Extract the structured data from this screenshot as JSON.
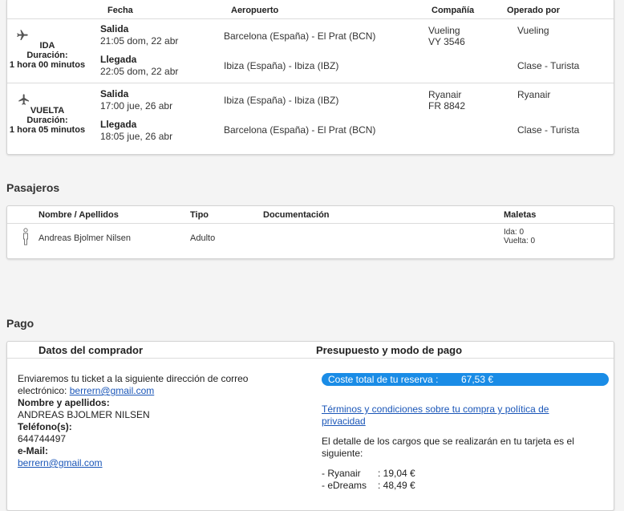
{
  "flights": {
    "headers": {
      "date": "Fecha",
      "airport": "Aeropuerto",
      "company": "Compañía",
      "operated_by": "Operado por"
    },
    "outbound": {
      "label": "IDA",
      "duration_label": "Duración:",
      "duration": "1 hora 00 minutos",
      "departure_label": "Salida",
      "departure_time": "21:05 dom, 22 abr",
      "arrival_label": "Llegada",
      "arrival_time": "22:05 dom, 22 abr",
      "origin": "Barcelona (España) - El Prat (BCN)",
      "destination": "Ibiza (España) - Ibiza (IBZ)",
      "airline": "Vueling",
      "flight_number": "VY 3546",
      "operator": "Vueling",
      "class": "Clase - Turista"
    },
    "return": {
      "label": "VUELTA",
      "duration_label": "Duración:",
      "duration": "1 hora 05 minutos",
      "departure_label": "Salida",
      "departure_time": "17:00 jue, 26 abr",
      "arrival_label": "Llegada",
      "arrival_time": "18:05 jue, 26 abr",
      "origin": "Ibiza (España) - Ibiza (IBZ)",
      "destination": "Barcelona (España) - El Prat (BCN)",
      "airline": "Ryanair",
      "flight_number": "FR 8842",
      "operator": "Ryanair",
      "class": "Clase - Turista"
    }
  },
  "passengers": {
    "title": "Pasajeros",
    "headers": {
      "name": "Nombre / Apellidos",
      "type": "Tipo",
      "documentation": "Documentación",
      "bags": "Maletas"
    },
    "rows": [
      {
        "name": "Andreas Bjolmer Nilsen",
        "type": "Adulto",
        "documentation": "",
        "bags_out": "Ida: 0",
        "bags_return": "Vuelta: 0"
      }
    ]
  },
  "payment": {
    "title": "Pago",
    "buyer_header": "Datos del comprador",
    "budget_header": "Presupuesto y modo de pago",
    "ticket_notice": "Enviaremos tu ticket a la siguiente dirección de correo electrónico:",
    "email": "berrern@gmail.com",
    "name_label": "Nombre y apellidos:",
    "name_value": "ANDREAS BJOLMER NILSEN",
    "phone_label": "Teléfono(s):",
    "phone_value": "644744497",
    "email_label": "e-Mail:",
    "total_label": "Coste total de tu reserva :",
    "total_value": "67,53 €",
    "terms_link": "Términos y condiciones sobre tu compra y política de privacidad",
    "charges_intro": "El detalle de los cargos que se realizarán en tu tarjeta es el siguiente:",
    "charges": [
      {
        "merchant": "- Ryanair",
        "amount": ": 19,04 €"
      },
      {
        "merchant": "- eDreams",
        "amount": ": 48,49 €"
      }
    ],
    "accent_color": "#1a8ce6"
  }
}
